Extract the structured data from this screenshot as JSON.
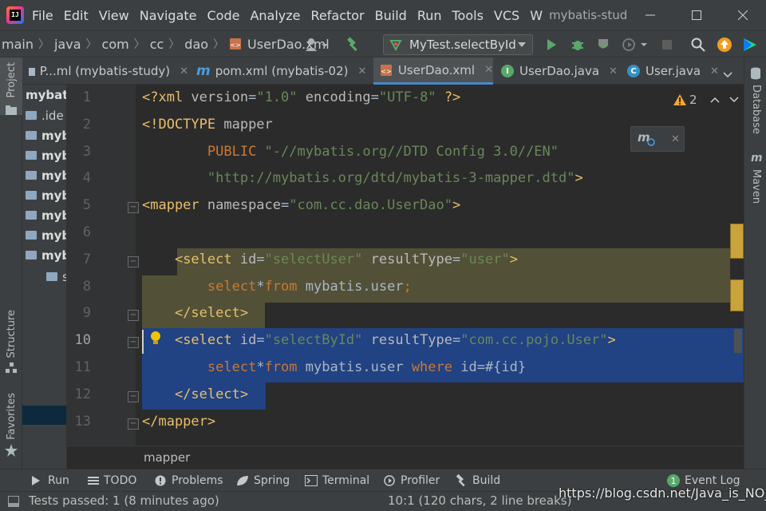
{
  "app": {
    "logo_text": "IJ",
    "menu": [
      "File",
      "Edit",
      "View",
      "Navigate",
      "Code",
      "Analyze",
      "Refactor",
      "Build",
      "Run",
      "Tools",
      "VCS",
      "W"
    ],
    "title": "mybatis-stud"
  },
  "navbar": {
    "crumbs": [
      "main",
      "java",
      "com",
      "cc",
      "dao",
      "UserDao.xml"
    ],
    "run_config": "MyTest.selectById"
  },
  "left_strip": {
    "project_label": "Project",
    "structure_label": "Structure",
    "favorites_label": "Favorites"
  },
  "right_strip": {
    "database_label": "Database",
    "maven_label": "Maven"
  },
  "project_tree": [
    {
      "label": "mybati",
      "bold": true
    },
    {
      "label": ".ide",
      "bold": false
    },
    {
      "label": "myb",
      "bold": true
    },
    {
      "label": "myb",
      "bold": true
    },
    {
      "label": "myb",
      "bold": true
    },
    {
      "label": "myb",
      "bold": true
    },
    {
      "label": "myb",
      "bold": true
    },
    {
      "label": "myb",
      "bold": true
    },
    {
      "label": "myb",
      "bold": true
    },
    {
      "label": "s",
      "bold": false
    }
  ],
  "tabs": [
    {
      "label": "P...ml (mybatis-study)",
      "icon": "m",
      "active": false
    },
    {
      "label": "pom.xml (mybatis-02)",
      "icon": "m",
      "active": false
    },
    {
      "label": "UserDao.xml",
      "icon": "xml",
      "active": true
    },
    {
      "label": "UserDao.java",
      "icon": "I",
      "active": false
    },
    {
      "label": "User.java",
      "icon": "C",
      "active": false
    }
  ],
  "editor": {
    "warning_count": "2",
    "lines": [
      {
        "no": "1",
        "tokens": [
          [
            "t-tag",
            "<?xml "
          ],
          [
            "t-attr",
            "version"
          ],
          [
            "t-plain",
            "="
          ],
          [
            "t-val",
            "\"1.0\""
          ],
          [
            "t-plain",
            " "
          ],
          [
            "t-attr",
            "encoding"
          ],
          [
            "t-plain",
            "="
          ],
          [
            "t-val",
            "\"UTF-8\""
          ],
          [
            "t-plain",
            " "
          ],
          [
            "t-tag",
            "?>"
          ]
        ]
      },
      {
        "no": "2",
        "tokens": [
          [
            "t-tag",
            "<!DOCTYPE "
          ],
          [
            "t-attr",
            "mapper"
          ]
        ]
      },
      {
        "no": "3",
        "tokens": [
          [
            "t-plain",
            "        "
          ],
          [
            "t-kw",
            "PUBLIC "
          ],
          [
            "t-val",
            "\"-//mybatis.org//DTD Config 3.0//EN\""
          ]
        ]
      },
      {
        "no": "4",
        "tokens": [
          [
            "t-plain",
            "        "
          ],
          [
            "t-val",
            "\"http://mybatis.org/dtd/mybatis-3-mapper.dtd\""
          ],
          [
            "t-tag",
            ">"
          ]
        ]
      },
      {
        "no": "5",
        "tokens": [
          [
            "t-tag",
            "<mapper "
          ],
          [
            "t-attr",
            "namespace"
          ],
          [
            "t-plain",
            "="
          ],
          [
            "t-val",
            "\"com.cc.dao.UserDao\""
          ],
          [
            "t-tag",
            ">"
          ]
        ]
      },
      {
        "no": "6",
        "tokens": []
      },
      {
        "no": "7",
        "tokens": [
          [
            "t-plain",
            "    "
          ],
          [
            "t-tag",
            "<select "
          ],
          [
            "t-attr",
            "id"
          ],
          [
            "t-plain",
            "="
          ],
          [
            "t-val",
            "\"selectUser\""
          ],
          [
            "t-plain",
            " "
          ],
          [
            "t-attr",
            "resultType"
          ],
          [
            "t-plain",
            "="
          ],
          [
            "t-val",
            "\"user\""
          ],
          [
            "t-tag",
            ">"
          ]
        ]
      },
      {
        "no": "8",
        "tokens": [
          [
            "t-plain",
            "        "
          ],
          [
            "t-kw",
            "select"
          ],
          [
            "t-plain",
            "*"
          ],
          [
            "t-kw",
            "from "
          ],
          [
            "t-plain",
            "mybatis.user"
          ],
          [
            "t-kw",
            ";"
          ]
        ]
      },
      {
        "no": "9",
        "tokens": [
          [
            "t-plain",
            "    "
          ],
          [
            "t-tag",
            "</select>"
          ]
        ]
      },
      {
        "no": "10",
        "tokens": [
          [
            "t-plain",
            "    "
          ],
          [
            "t-tag",
            "<select "
          ],
          [
            "t-attr",
            "id"
          ],
          [
            "t-plain",
            "="
          ],
          [
            "t-val",
            "\"selectById\""
          ],
          [
            "t-plain",
            " "
          ],
          [
            "t-attr",
            "resultType"
          ],
          [
            "t-plain",
            "="
          ],
          [
            "t-val",
            "\"com.cc.pojo.User\""
          ],
          [
            "t-tag",
            ">"
          ]
        ]
      },
      {
        "no": "11",
        "tokens": [
          [
            "t-plain",
            "        "
          ],
          [
            "t-kw",
            "select"
          ],
          [
            "t-plain",
            "*"
          ],
          [
            "t-kw",
            "from "
          ],
          [
            "t-plain",
            "mybatis.user "
          ],
          [
            "t-kw",
            "where "
          ],
          [
            "t-plain",
            "id=#{id}"
          ]
        ]
      },
      {
        "no": "12",
        "tokens": [
          [
            "t-plain",
            "    "
          ],
          [
            "t-tag",
            "</select>"
          ]
        ]
      },
      {
        "no": "13",
        "tokens": [
          [
            "t-tag",
            "</mapper>"
          ]
        ]
      }
    ],
    "breadcrumb": "mapper"
  },
  "tool_windows": [
    {
      "label": "Run",
      "icon": "play-icon"
    },
    {
      "label": "TODO",
      "icon": "list-icon"
    },
    {
      "label": "Problems",
      "icon": "info-icon"
    },
    {
      "label": "Spring",
      "icon": "leaf-icon"
    },
    {
      "label": "Terminal",
      "icon": "terminal-icon"
    },
    {
      "label": "Profiler",
      "icon": "profiler-icon"
    },
    {
      "label": "Build",
      "icon": "hammer-icon"
    }
  ],
  "event_log": {
    "count": "1",
    "label": "Event Log"
  },
  "status": {
    "left": "Tests passed: 1 (8 minutes ago)",
    "right": "10:1 (120 chars, 2 line breaks)"
  },
  "watermark": "https://blog.csdn.net/Java_is_NO_1",
  "colors": {
    "accent": "#4a88c7",
    "selection": "#214283",
    "highlight": "#525037",
    "run_green": "#59a869",
    "update_orange": "#f39c1f"
  }
}
